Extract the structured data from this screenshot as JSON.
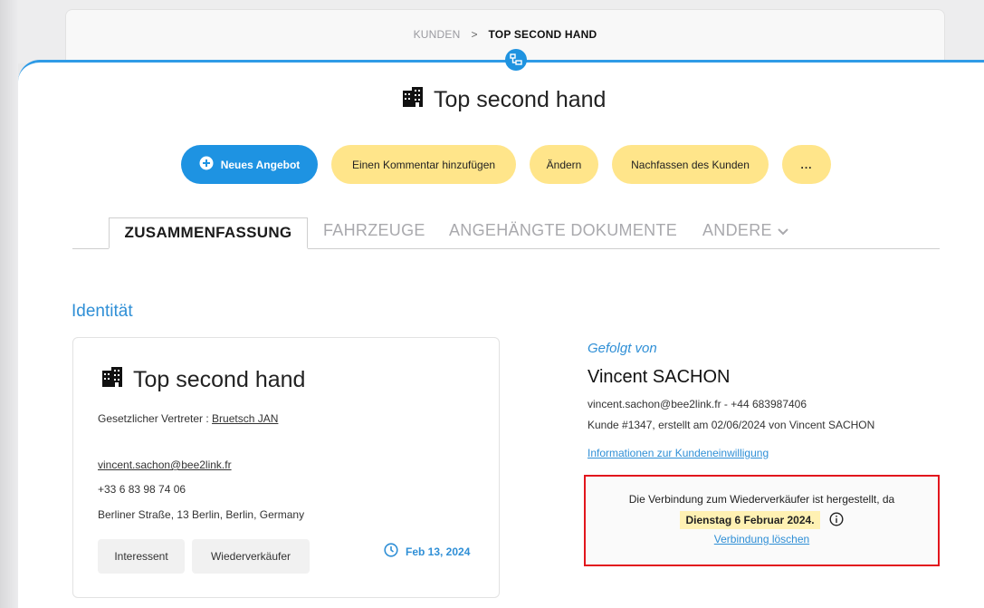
{
  "breadcrumb": {
    "parent": "KUNDEN",
    "separator": ">",
    "current": "TOP SECOND HAND"
  },
  "page": {
    "title": "Top second hand",
    "icon": "building-icon"
  },
  "actions": {
    "new_offer": "Neues Angebot",
    "add_comment": "Einen Kommentar hinzufügen",
    "edit": "Ändern",
    "follow_up": "Nachfassen des Kunden",
    "more": "..."
  },
  "tabs": [
    {
      "label": "ZUSAMMENFASSUNG",
      "active": true
    },
    {
      "label": "FAHRZEUGE",
      "active": false
    },
    {
      "label": "ANGEHÄNGTE DOKUMENTE",
      "active": false
    },
    {
      "label": "ANDERE",
      "active": false
    }
  ],
  "identity": {
    "section_title": "Identität",
    "name": "Top second hand",
    "legal_rep_label": "Gesetzlicher Vertreter : ",
    "legal_rep_name": "Bruetsch JAN",
    "email": "vincent.sachon@bee2link.fr",
    "phone": "+33 6 83 98 74 06",
    "address": "Berliner Straße, 13 Berlin, Berlin, Germany",
    "tags": [
      "Interessent",
      "Wiederverkäufer"
    ],
    "date": "Feb 13, 2024"
  },
  "followed_by": {
    "label": "Gefolgt von",
    "name": "Vincent SACHON",
    "contact": "vincent.sachon@bee2link.fr - +44 683987406",
    "meta": "Kunde #1347, erstellt am 02/06/2024 von Vincent SACHON",
    "consent_link": "Informationen zur Kundeneinwilligung"
  },
  "notice": {
    "line1": "Die Verbindung zum Wiederverkäufer ist hergestellt, da",
    "date": "Dienstag 6 Februar 2024.",
    "link": "Verbindung löschen"
  },
  "colors": {
    "accent": "#1e93e2",
    "button_yellow": "#ffe58a",
    "highlight": "#e2161d"
  }
}
